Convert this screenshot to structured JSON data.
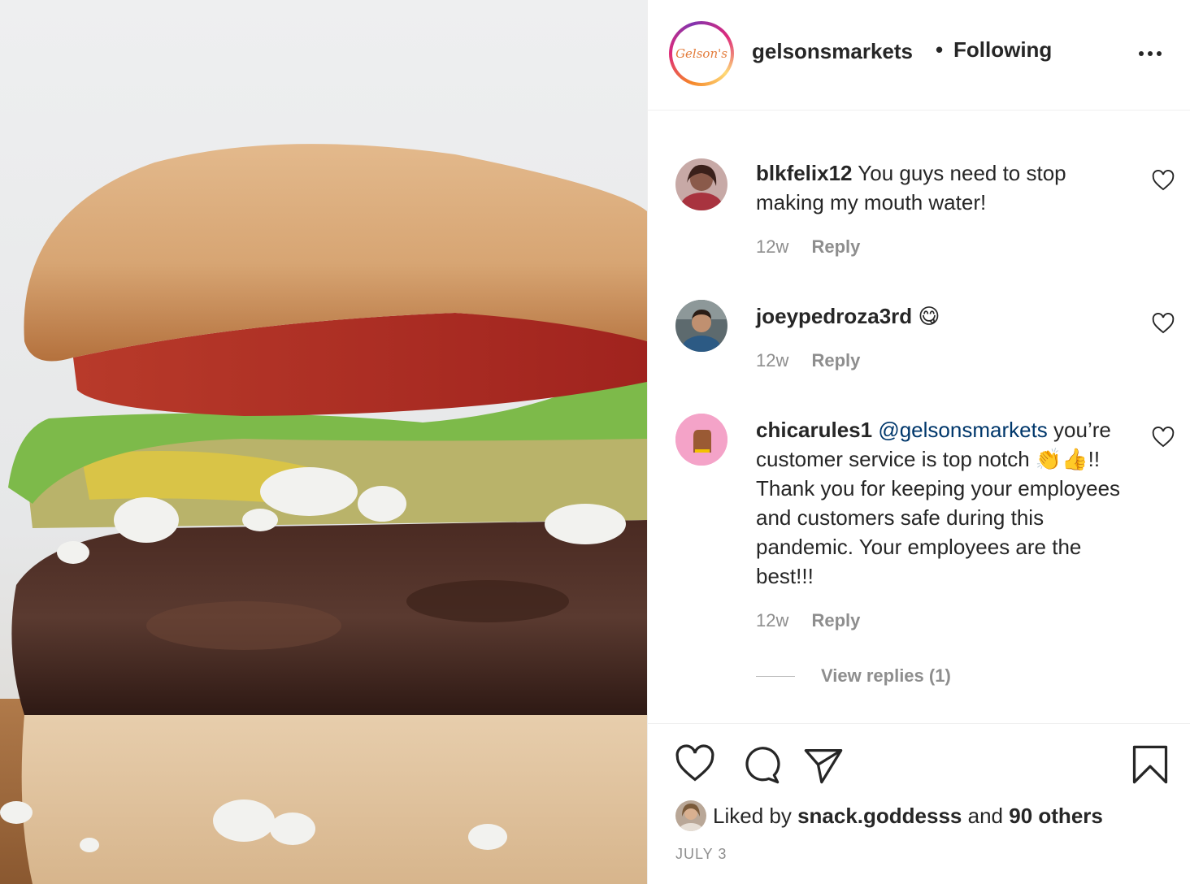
{
  "post": {
    "image_alt": "cheeseburger with tomato, lettuce, pickles and blue cheese",
    "account": {
      "username": "gelsonsmarkets",
      "separator": "•",
      "follow_status": "Following",
      "logo_text": "Gelson's"
    }
  },
  "comments": [
    {
      "username": "blkfelix12",
      "text": "You guys need to stop making my mouth water!",
      "time": "12w",
      "reply_label": "Reply"
    },
    {
      "username": "joeypedroza3rd",
      "text": "😋",
      "time": "12w",
      "reply_label": "Reply"
    },
    {
      "username": "chicarules1",
      "mention": "@gelsonsmarkets",
      "text": "you’re customer service is top notch 👏👍!! Thank you for keeping your employees and customers safe during this pandemic. Your employees are the best!!!",
      "time": "12w",
      "reply_label": "Reply",
      "view_replies": "View replies (1)"
    }
  ],
  "likes": {
    "prefix": "Liked by",
    "user": "snack.goddesss",
    "middle": "and",
    "others": "90 others"
  },
  "date": "JULY 3"
}
